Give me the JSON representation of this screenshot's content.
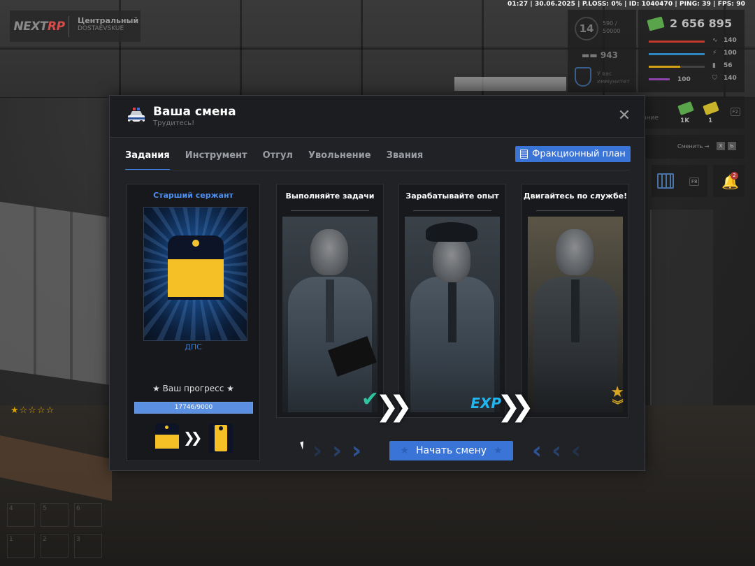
{
  "hud": {
    "status_line": "01:27 | 30.06.2025 | P.LOSS: 0% | ID: 1040470 | PING: 39 | FPS: 90",
    "logo_next": "NEXT",
    "logo_rp": "RP",
    "server_name": "Центральный",
    "server_sub": "DOSTAEVSKUE",
    "level": "14",
    "exp": "590 /",
    "exp_max": "50000",
    "reputation": "943",
    "immunity_line1": "У вас",
    "immunity_line2": "иммунитет",
    "money": "2 656 895",
    "stats": [
      {
        "icon": "heart-rate-icon",
        "value": "140",
        "color": "#c0392b",
        "fill": 1.0
      },
      {
        "icon": "hunger-icon",
        "value": "100",
        "color": "#2e86c1",
        "fill": 1.0
      },
      {
        "icon": "stamina-icon",
        "value": "56",
        "color": "#d4a017",
        "fill": 0.56
      },
      {
        "icon": "armor-icon",
        "value": "140",
        "color": "#8e44ad",
        "fill": 1.0
      }
    ],
    "armor_left": "100",
    "job_label": "дание",
    "bill1_value": "1K",
    "bill2_value": "1",
    "f2_key": "F2",
    "change_label": "Сменить →",
    "key_x": "X",
    "key_b": "Ь",
    "f8_key": "F8",
    "bell_count": "2",
    "stars": "★☆☆☆☆"
  },
  "modal": {
    "title": "Ваша смена",
    "subtitle": "Трудитесь!",
    "tabs": [
      {
        "label": "Задания",
        "active": true
      },
      {
        "label": "Инструмент",
        "active": false
      },
      {
        "label": "Отгул",
        "active": false
      },
      {
        "label": "Увольнение",
        "active": false
      },
      {
        "label": "Звания",
        "active": false
      }
    ],
    "plan_button": "Фракционный план",
    "rank": {
      "title": "Старший сержант",
      "unit": "ДПС",
      "progress_label": "★ Ваш прогресс ★",
      "progress_text": "17746/9000",
      "progress_fraction": 1.0
    },
    "steps": [
      {
        "title": "Выполняйте задачи",
        "badge": "✔"
      },
      {
        "title": "Зарабатывайте опыт",
        "badge": "EXP"
      },
      {
        "title": "Двигайтесь по службе!",
        "badge": "★"
      }
    ],
    "start_button": "Начать смену",
    "colors": {
      "accent": "#3a74d6",
      "rank_title": "#4f8ff0",
      "strap_yellow": "#f4c025"
    }
  }
}
